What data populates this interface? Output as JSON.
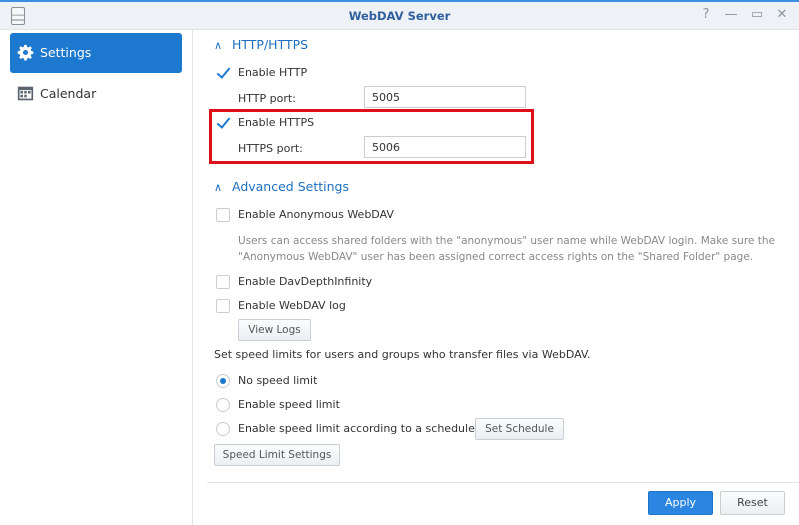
{
  "window": {
    "title": "WebDAV Server",
    "controls": {
      "help": "?",
      "minimize": "—",
      "maximize": "▭",
      "close": "✕"
    }
  },
  "sidebar": {
    "items": [
      {
        "label": "Settings",
        "icon": "gear-icon",
        "active": true
      },
      {
        "label": "Calendar",
        "icon": "calendar-icon",
        "active": false
      }
    ]
  },
  "http_section": {
    "title": "HTTP/HTTPS",
    "enable_http": {
      "label": "Enable HTTP",
      "checked": true
    },
    "http_port": {
      "label": "HTTP port:",
      "value": "5005"
    },
    "enable_https": {
      "label": "Enable HTTPS",
      "checked": true
    },
    "https_port": {
      "label": "HTTPS port:",
      "value": "5006"
    }
  },
  "advanced_section": {
    "title": "Advanced Settings",
    "anonymous": {
      "label": "Enable Anonymous WebDAV",
      "checked": false
    },
    "anonymous_desc_1": "Users can access shared folders with the \"anonymous\" user name while WebDAV login. Make sure the",
    "anonymous_desc_2": "\"Anonymous WebDAV\" user has been assigned correct access rights on the \"Shared Folder\" page.",
    "depth_infinity": {
      "label": "Enable DavDepthInfinity",
      "checked": false
    },
    "webdav_log": {
      "label": "Enable WebDAV log",
      "checked": false
    },
    "view_logs_label": "View Logs",
    "speed_intro": "Set speed limits for users and groups who transfer files via WebDAV.",
    "speed_options": [
      {
        "label": "No speed limit",
        "selected": true
      },
      {
        "label": "Enable speed limit",
        "selected": false
      },
      {
        "label": "Enable speed limit according to a schedule",
        "selected": false
      }
    ],
    "set_schedule_label": "Set Schedule",
    "speed_limit_settings_label": "Speed Limit Settings"
  },
  "footer": {
    "apply_label": "Apply",
    "reset_label": "Reset"
  },
  "colors": {
    "accent": "#1c79cf",
    "highlight": "#e0101a",
    "section_title": "#1e6fc1"
  }
}
